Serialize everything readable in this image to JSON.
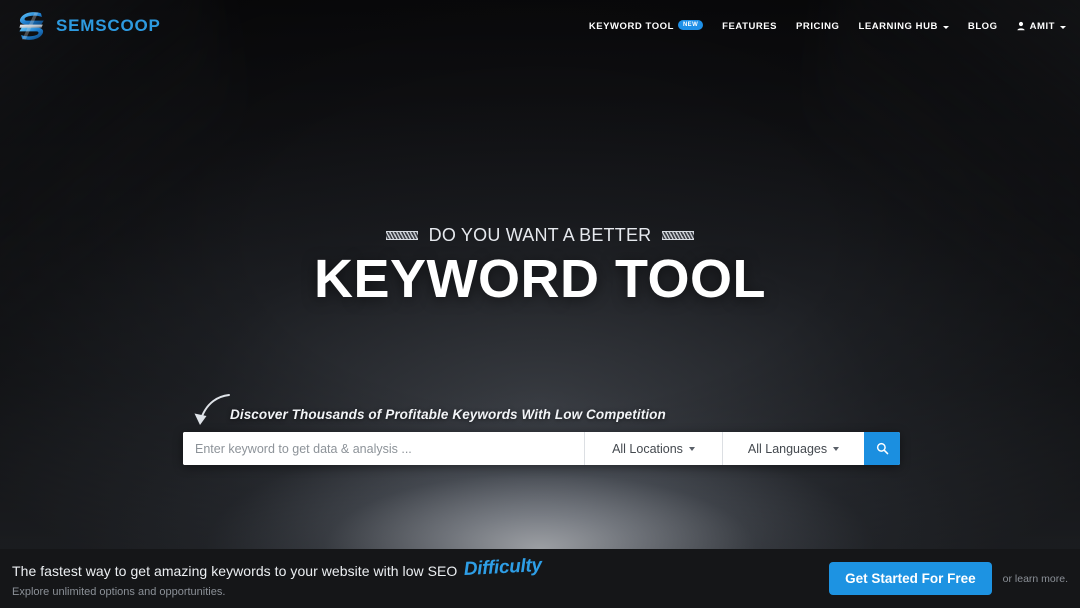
{
  "brand": {
    "name": "SEMSCOOP",
    "logo_icon": "semscoop-s-logo",
    "accent_color": "#2d9ae0"
  },
  "nav": {
    "items": [
      {
        "label": "KEYWORD TOOL",
        "badge": "NEW",
        "has_caret": false
      },
      {
        "label": "FEATURES",
        "has_caret": false
      },
      {
        "label": "PRICING",
        "has_caret": false
      },
      {
        "label": "LEARNING HUB",
        "has_caret": true
      },
      {
        "label": "BLOG",
        "has_caret": false
      },
      {
        "label": "AMIT",
        "has_caret": true,
        "icon": "user-icon"
      }
    ]
  },
  "hero": {
    "eyebrow": "DO YOU WANT A BETTER",
    "title": "KEYWORD TOOL",
    "tagline": "Discover Thousands of Profitable Keywords With Low Competition",
    "arrow_icon": "curved-arrow-down-icon"
  },
  "search": {
    "placeholder": "Enter keyword to get data & analysis ...",
    "value": "",
    "locations_label": "All Locations",
    "languages_label": "All Languages",
    "search_icon": "search-icon",
    "button_color": "#1b8fe0"
  },
  "bottom_bar": {
    "headline_main": "The fastest way to get amazing keywords to your website with low SEO",
    "headline_accent": "Difficulty",
    "subline": "Explore unlimited options and opportunities.",
    "cta_label": "Get Started For Free",
    "learn_more": "or learn more.",
    "cta_color": "#1d93e2"
  }
}
